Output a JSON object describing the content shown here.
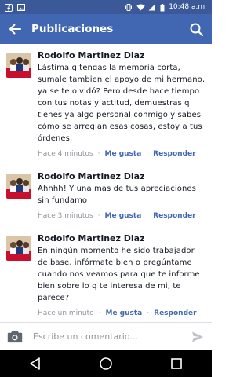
{
  "status_bar": {
    "time": "10:48 a.m.",
    "icons": [
      "facebook-icon",
      "image-icon",
      "vibrate-icon",
      "wifi-icon",
      "signal-icon",
      "battery-icon"
    ]
  },
  "header": {
    "title": "Publicaciones",
    "back_icon": "back-arrow-icon",
    "search_icon": "search-icon"
  },
  "comments": [
    {
      "author": "Rodolfo Martinez Diaz",
      "text": "Lástima q tengas la memoria corta, sumale tambien el apoyo de mi hermano, ya se te olvidó? Pero desde hace tiempo con tus notas y actitud, demuestras q tienes ya algo personal conmigo y sabes cómo se arreglan esas cosas, estoy a tus órdenes.",
      "time": "Hace 4 minutos",
      "like_label": "Me gusta",
      "reply_label": "Responder"
    },
    {
      "author": "Rodolfo Martinez Diaz",
      "text": "Ahhhh! Y una más de tus apreciaciones sin fundamo",
      "time": "Hace 3 minutos",
      "like_label": "Me gusta",
      "reply_label": "Responder"
    },
    {
      "author": "Rodolfo Martinez Diaz",
      "text": "En ningún momento he sido trabajador de base, infórmate bien o pregúntame cuando nos veamos para que te informe bien sobre lo q te interesa de mi, te parece?",
      "time": "Hace un minuto",
      "like_label": "Me gusta",
      "reply_label": "Responder"
    }
  ],
  "composer": {
    "placeholder": "Escribe un comentario...",
    "camera_icon": "camera-icon",
    "send_icon": "send-icon"
  },
  "colors": {
    "status_bar": "#3b5998",
    "app_bar": "#4267b2",
    "link": "#4267b2",
    "meta_gray": "#90949c",
    "text": "#141823"
  }
}
